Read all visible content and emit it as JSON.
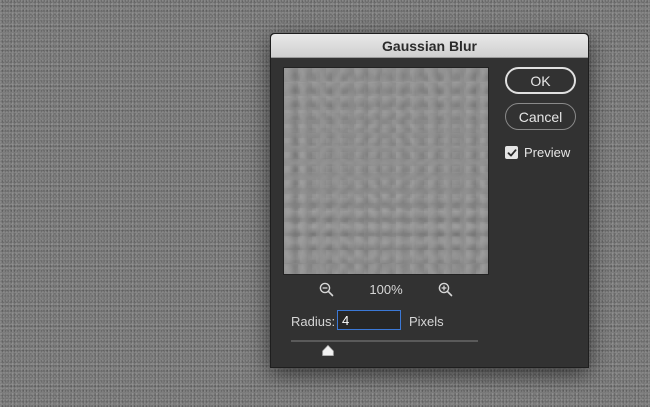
{
  "dialog": {
    "title": "Gaussian Blur",
    "ok_label": "OK",
    "cancel_label": "Cancel",
    "preview": {
      "label": "Preview",
      "checked": true
    },
    "zoom": {
      "level": "100%"
    },
    "radius": {
      "label": "Radius:",
      "value": "4",
      "unit": "Pixels",
      "slider_fraction": 0.2
    }
  },
  "icons": {
    "zoom_out": "zoom-out-icon",
    "zoom_in": "zoom-in-icon",
    "check": "checkmark-icon"
  },
  "colors": {
    "dialog_bg": "#323232",
    "focus_ring": "#3b78d6"
  }
}
